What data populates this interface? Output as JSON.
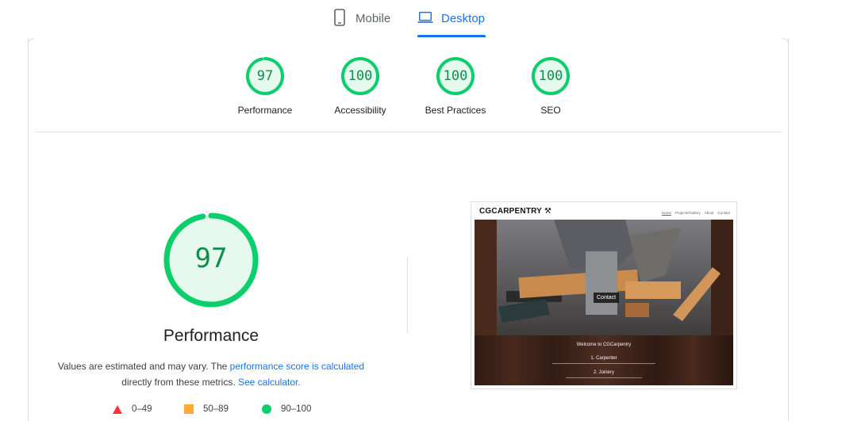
{
  "tabs": {
    "mobile_label": "Mobile",
    "desktop_label": "Desktop",
    "active": "Desktop"
  },
  "categories": [
    {
      "label": "Performance",
      "score": "97"
    },
    {
      "label": "Accessibility",
      "score": "100"
    },
    {
      "label": "Best Practices",
      "score": "100"
    },
    {
      "label": "SEO",
      "score": "100"
    }
  ],
  "main": {
    "score": "97",
    "score_fraction": 0.97,
    "title": "Performance",
    "desc_text1": "Values are estimated and may vary. The ",
    "desc_link1": "performance score is calculated",
    "desc_text2": "directly from these metrics. ",
    "desc_link2": "See calculator."
  },
  "legend": [
    {
      "range": "0–49",
      "shape": "triangle",
      "color": "#ff3333"
    },
    {
      "range": "50–89",
      "shape": "square",
      "color": "#ffaa33"
    },
    {
      "range": "90–100",
      "shape": "circle",
      "color": "#0cce6b"
    }
  ],
  "colors": {
    "pass": "#0cce6b",
    "pass_text": "#0c8f4a",
    "pass_bg": "#e6f9ef",
    "accent": "#1a73e8"
  },
  "thumbnail": {
    "logo": "CGCARPENTRY",
    "nav": [
      "Home",
      "Projects/Gallery",
      "About",
      "Contact"
    ],
    "contact_button": "Contact",
    "welcome": "Welcome to CGCarpentry",
    "heading1": "1. Carpenter",
    "heading2": "2. Joinery"
  }
}
